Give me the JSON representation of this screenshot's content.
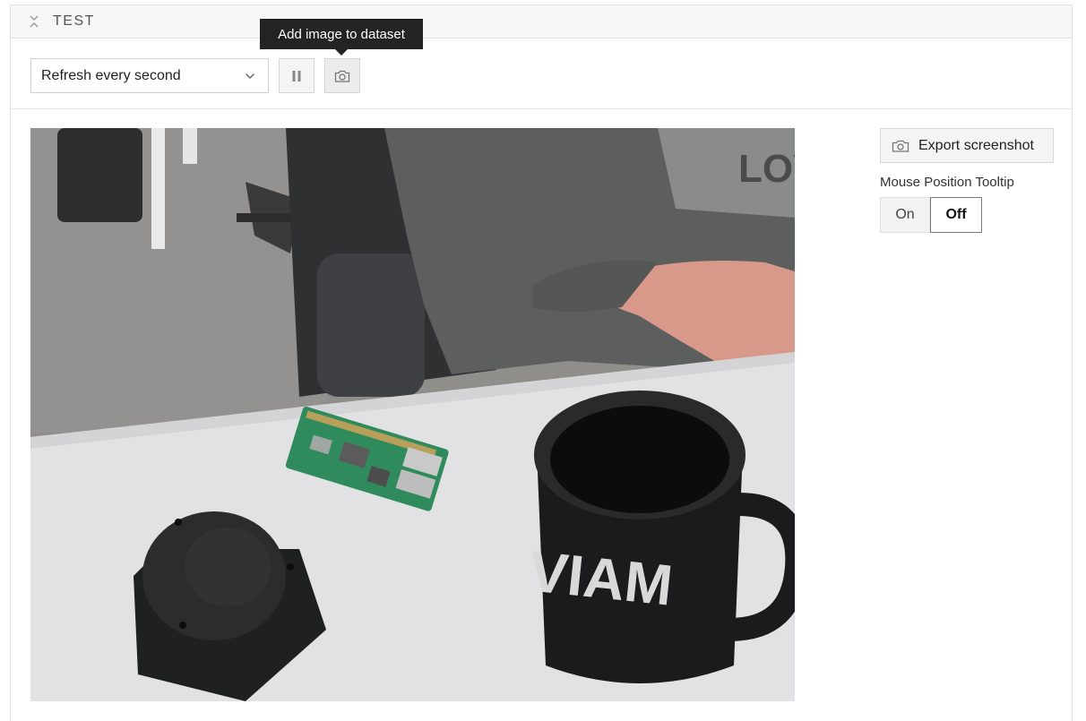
{
  "panel": {
    "title": "TEST"
  },
  "toolbar": {
    "refresh_select": {
      "value": "Refresh every second"
    },
    "pause_button_icon": "pause-icon",
    "camera_button_icon": "camera-icon",
    "tooltip": "Add image to dataset"
  },
  "stream": {
    "mug_text": "VIAM"
  },
  "sidebar": {
    "export_label": "Export screenshot",
    "mouse_tooltip_label": "Mouse Position Tooltip",
    "toggle": {
      "on_label": "On",
      "off_label": "Off",
      "selected": "Off"
    }
  },
  "colors": {
    "header_bg": "#f6f6f6",
    "border": "#e2e2e2",
    "tooltip_bg": "#232323"
  }
}
